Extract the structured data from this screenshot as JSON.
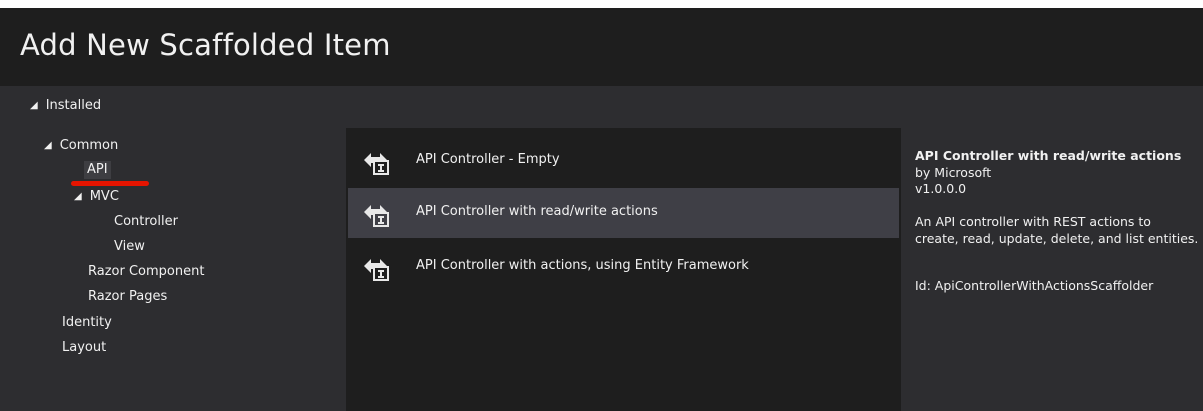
{
  "dialog": {
    "title": "Add New Scaffolded Item"
  },
  "tree": {
    "installed": "Installed",
    "common": "Common",
    "api": "API",
    "mvc": "MVC",
    "controller": "Controller",
    "view": "View",
    "razor_component": "Razor Component",
    "razor_pages": "Razor Pages",
    "identity": "Identity",
    "layout": "Layout"
  },
  "templates": [
    {
      "label": "API Controller - Empty",
      "icon": "api-controller-icon"
    },
    {
      "label": "API Controller with read/write actions",
      "icon": "api-controller-icon"
    },
    {
      "label": "API Controller with actions, using Entity Framework",
      "icon": "api-controller-icon"
    }
  ],
  "selected_template_index": 1,
  "details": {
    "title": "API Controller with read/write actions",
    "author": "by Microsoft",
    "version": "v1.0.0.0",
    "description_line1": "An API controller with REST actions to",
    "description_line2": "create, read, update, delete, and list entities.",
    "id": "Id: ApiControllerWithActionsScaffolder"
  },
  "colors": {
    "title_bar": "#1e1e1e",
    "panel": "#2d2d30",
    "list_bg": "#1e1e1e",
    "selected_row": "#3f3f46",
    "annotation_underline": "#e51400"
  }
}
